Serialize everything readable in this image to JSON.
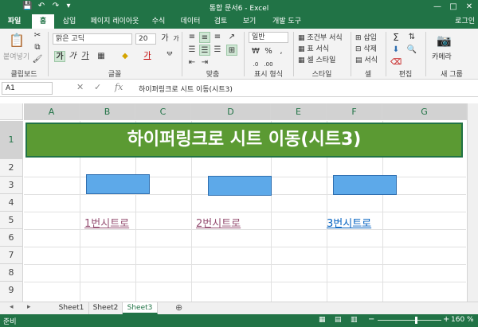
{
  "window": {
    "title": "통합 문서6 - Excel",
    "minimize": "—",
    "maximize": "□",
    "close": "✕"
  },
  "qat": {
    "save": "💾",
    "undo": "↶",
    "redo": "↷",
    "more": "▾"
  },
  "tabs": [
    {
      "label": "파일"
    },
    {
      "label": "홈"
    },
    {
      "label": "삽입"
    },
    {
      "label": "페이지 레이아웃"
    },
    {
      "label": "수식"
    },
    {
      "label": "데이터"
    },
    {
      "label": "검토"
    },
    {
      "label": "보기"
    },
    {
      "label": "개발 도구"
    }
  ],
  "login": "로그인",
  "ribbon": {
    "paste": "붙여넣기",
    "font_name": "맑은 고딕",
    "font_size": "20",
    "number_format": "일반",
    "conditional": "조건부 서식",
    "table_format": "표 서식",
    "cell_style": "셀 스타일",
    "insert": "삽입",
    "delete": "삭제",
    "format": "서식",
    "camera": "카메라",
    "groups": [
      "클립보드",
      "글꼴",
      "맞춤",
      "표시 형식",
      "스타일",
      "셀",
      "편집",
      "새 그룹"
    ]
  },
  "formula_bar": {
    "cell_ref": "A1",
    "fx": "fx",
    "formula": "하이퍼링크로 시트 이동(시트3)"
  },
  "columns": [
    "A",
    "B",
    "C",
    "D",
    "E",
    "F",
    "G"
  ],
  "rows": [
    "1",
    "2",
    "3",
    "4",
    "5",
    "6",
    "7",
    "8",
    "9"
  ],
  "sheet": {
    "banner": "하이퍼링크로 시트 이동(시트3)",
    "links": [
      "1번시트로",
      "2번시트로",
      "3번시트로"
    ],
    "link_colors": [
      "#954f72",
      "#954f72",
      "#0563c1"
    ]
  },
  "sheet_tabs": [
    {
      "label": "Sheet1"
    },
    {
      "label": "Sheet2"
    },
    {
      "label": "Sheet3"
    }
  ],
  "add_sheet": "⊕",
  "status": {
    "mode": "준비",
    "zoom": "160 %",
    "zoom_fraction": 0.6
  },
  "colors": {
    "excel_green": "#217346",
    "banner_fill": "#5b9a33",
    "shape_fill": "#5da9e9"
  }
}
